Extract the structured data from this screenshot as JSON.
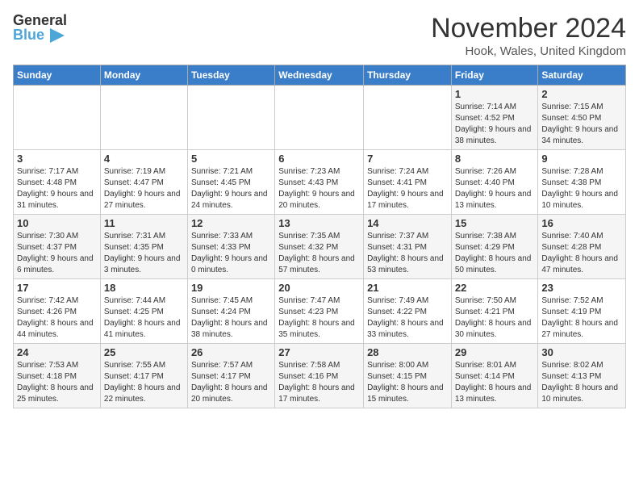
{
  "header": {
    "logo_general": "General",
    "logo_blue": "Blue",
    "month_title": "November 2024",
    "location": "Hook, Wales, United Kingdom"
  },
  "days_of_week": [
    "Sunday",
    "Monday",
    "Tuesday",
    "Wednesday",
    "Thursday",
    "Friday",
    "Saturday"
  ],
  "weeks": [
    [
      {
        "day": "",
        "detail": ""
      },
      {
        "day": "",
        "detail": ""
      },
      {
        "day": "",
        "detail": ""
      },
      {
        "day": "",
        "detail": ""
      },
      {
        "day": "",
        "detail": ""
      },
      {
        "day": "1",
        "detail": "Sunrise: 7:14 AM\nSunset: 4:52 PM\nDaylight: 9 hours and 38 minutes."
      },
      {
        "day": "2",
        "detail": "Sunrise: 7:15 AM\nSunset: 4:50 PM\nDaylight: 9 hours and 34 minutes."
      }
    ],
    [
      {
        "day": "3",
        "detail": "Sunrise: 7:17 AM\nSunset: 4:48 PM\nDaylight: 9 hours and 31 minutes."
      },
      {
        "day": "4",
        "detail": "Sunrise: 7:19 AM\nSunset: 4:47 PM\nDaylight: 9 hours and 27 minutes."
      },
      {
        "day": "5",
        "detail": "Sunrise: 7:21 AM\nSunset: 4:45 PM\nDaylight: 9 hours and 24 minutes."
      },
      {
        "day": "6",
        "detail": "Sunrise: 7:23 AM\nSunset: 4:43 PM\nDaylight: 9 hours and 20 minutes."
      },
      {
        "day": "7",
        "detail": "Sunrise: 7:24 AM\nSunset: 4:41 PM\nDaylight: 9 hours and 17 minutes."
      },
      {
        "day": "8",
        "detail": "Sunrise: 7:26 AM\nSunset: 4:40 PM\nDaylight: 9 hours and 13 minutes."
      },
      {
        "day": "9",
        "detail": "Sunrise: 7:28 AM\nSunset: 4:38 PM\nDaylight: 9 hours and 10 minutes."
      }
    ],
    [
      {
        "day": "10",
        "detail": "Sunrise: 7:30 AM\nSunset: 4:37 PM\nDaylight: 9 hours and 6 minutes."
      },
      {
        "day": "11",
        "detail": "Sunrise: 7:31 AM\nSunset: 4:35 PM\nDaylight: 9 hours and 3 minutes."
      },
      {
        "day": "12",
        "detail": "Sunrise: 7:33 AM\nSunset: 4:33 PM\nDaylight: 9 hours and 0 minutes."
      },
      {
        "day": "13",
        "detail": "Sunrise: 7:35 AM\nSunset: 4:32 PM\nDaylight: 8 hours and 57 minutes."
      },
      {
        "day": "14",
        "detail": "Sunrise: 7:37 AM\nSunset: 4:31 PM\nDaylight: 8 hours and 53 minutes."
      },
      {
        "day": "15",
        "detail": "Sunrise: 7:38 AM\nSunset: 4:29 PM\nDaylight: 8 hours and 50 minutes."
      },
      {
        "day": "16",
        "detail": "Sunrise: 7:40 AM\nSunset: 4:28 PM\nDaylight: 8 hours and 47 minutes."
      }
    ],
    [
      {
        "day": "17",
        "detail": "Sunrise: 7:42 AM\nSunset: 4:26 PM\nDaylight: 8 hours and 44 minutes."
      },
      {
        "day": "18",
        "detail": "Sunrise: 7:44 AM\nSunset: 4:25 PM\nDaylight: 8 hours and 41 minutes."
      },
      {
        "day": "19",
        "detail": "Sunrise: 7:45 AM\nSunset: 4:24 PM\nDaylight: 8 hours and 38 minutes."
      },
      {
        "day": "20",
        "detail": "Sunrise: 7:47 AM\nSunset: 4:23 PM\nDaylight: 8 hours and 35 minutes."
      },
      {
        "day": "21",
        "detail": "Sunrise: 7:49 AM\nSunset: 4:22 PM\nDaylight: 8 hours and 33 minutes."
      },
      {
        "day": "22",
        "detail": "Sunrise: 7:50 AM\nSunset: 4:21 PM\nDaylight: 8 hours and 30 minutes."
      },
      {
        "day": "23",
        "detail": "Sunrise: 7:52 AM\nSunset: 4:19 PM\nDaylight: 8 hours and 27 minutes."
      }
    ],
    [
      {
        "day": "24",
        "detail": "Sunrise: 7:53 AM\nSunset: 4:18 PM\nDaylight: 8 hours and 25 minutes."
      },
      {
        "day": "25",
        "detail": "Sunrise: 7:55 AM\nSunset: 4:17 PM\nDaylight: 8 hours and 22 minutes."
      },
      {
        "day": "26",
        "detail": "Sunrise: 7:57 AM\nSunset: 4:17 PM\nDaylight: 8 hours and 20 minutes."
      },
      {
        "day": "27",
        "detail": "Sunrise: 7:58 AM\nSunset: 4:16 PM\nDaylight: 8 hours and 17 minutes."
      },
      {
        "day": "28",
        "detail": "Sunrise: 8:00 AM\nSunset: 4:15 PM\nDaylight: 8 hours and 15 minutes."
      },
      {
        "day": "29",
        "detail": "Sunrise: 8:01 AM\nSunset: 4:14 PM\nDaylight: 8 hours and 13 minutes."
      },
      {
        "day": "30",
        "detail": "Sunrise: 8:02 AM\nSunset: 4:13 PM\nDaylight: 8 hours and 10 minutes."
      }
    ]
  ]
}
